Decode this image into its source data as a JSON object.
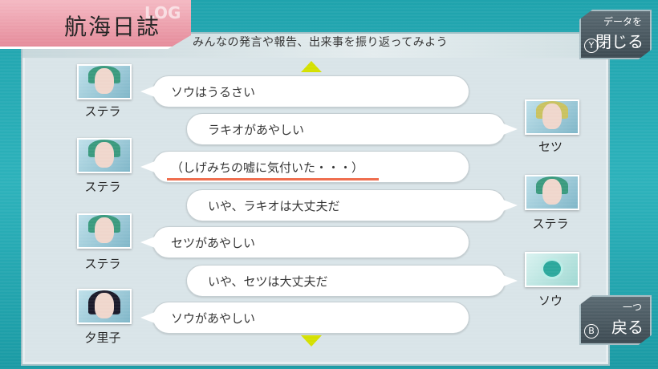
{
  "header": {
    "title": "航海日誌",
    "subtitle": "みんなの発言や報告、出来事を振り返ってみよう"
  },
  "buttons": {
    "close": {
      "small": "データを",
      "big": "閉じる",
      "key": "Y"
    },
    "back": {
      "small": "一つ",
      "big": "戻る",
      "key": "B"
    }
  },
  "messages": [
    {
      "speaker": "ステラ",
      "side": "left",
      "text": "ソウはうるさい"
    },
    {
      "speaker": "セツ",
      "side": "right",
      "text": "ラキオがあやしい"
    },
    {
      "speaker": "ステラ",
      "side": "left",
      "text": "（しげみちの嘘に気付いた・・・）",
      "highlight": true
    },
    {
      "speaker": "ステラ",
      "side": "right",
      "text": "いや、ラキオは大丈夫だ"
    },
    {
      "speaker": "ステラ",
      "side": "left",
      "text": "セツがあやしい"
    },
    {
      "speaker": "ソウ",
      "side": "right",
      "text": "いや、セツは大丈夫だ"
    },
    {
      "speaker": "夕里子",
      "side": "left",
      "text": "ソウがあやしい"
    }
  ],
  "colors": {
    "accent": "#d4e000",
    "title_tab": "#e58b9a",
    "highlight_underline": "#ee6a4a"
  }
}
